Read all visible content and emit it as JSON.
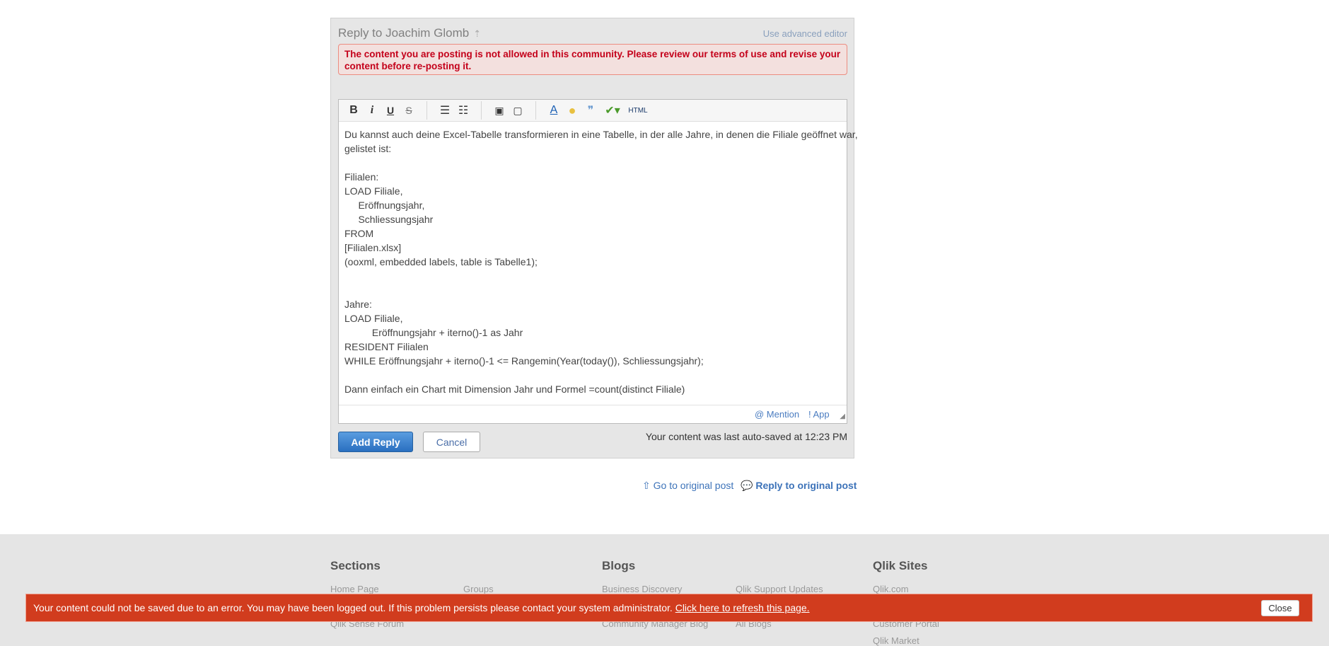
{
  "reply": {
    "title": "Reply to Joachim Glomb",
    "advanced_editor": "Use advanced editor",
    "error": "The content you are posting is not allowed in this community. Please review our terms of use and revise your content before re-posting it.",
    "toolbar": {
      "bold": "B",
      "italic": "i",
      "underline": "U",
      "strike": "S",
      "html": "HTML"
    },
    "content_lines": [
      "Du kannst auch deine Excel-Tabelle transformieren in eine Tabelle, in der alle Jahre, in denen die Filiale geöffnet war,",
      "gelistet ist:",
      "",
      "Filialen:",
      "LOAD Filiale,",
      "     Eröffnungsjahr,",
      "     Schliessungsjahr",
      "FROM",
      "[Filialen.xlsx]",
      "(ooxml, embedded labels, table is Tabelle1);",
      "",
      "",
      "Jahre:",
      "LOAD Filiale,",
      "          Eröffnungsjahr + iterno()-1 as Jahr",
      "RESIDENT Filialen",
      "WHILE Eröffnungsjahr + iterno()-1 <= Rangemin(Year(today()), Schliessungsjahr);",
      "",
      "Dann einfach ein Chart mit Dimension Jahr und Formel =count(distinct Filiale)"
    ],
    "mention": "@ Mention",
    "app": "! App",
    "add_reply": "Add Reply",
    "cancel": "Cancel",
    "autosave": "Your content was last auto-saved at 12:23 PM"
  },
  "links": {
    "go_original": "Go to original post",
    "reply_original": "Reply to original post"
  },
  "footer": {
    "sections": {
      "heading": "Sections",
      "items": [
        "Home Page",
        "Groups",
        "Qlik Sense Forum"
      ]
    },
    "blogs": {
      "heading": "Blogs",
      "items": [
        "Business Discovery",
        "Qlik Support Updates",
        "Community Manager Blog",
        "All Blogs"
      ]
    },
    "sites": {
      "heading": "Qlik Sites",
      "items": [
        "Qlik.com",
        "Customer Portal",
        "Qlik Market"
      ]
    }
  },
  "error_bar": {
    "message": "Your content could not be saved due to an error. You may have been logged out. If this problem persists please contact your system administrator. ",
    "refresh_link": "Click here to refresh this page.",
    "close": "Close",
    "color": "#d13c1e"
  }
}
